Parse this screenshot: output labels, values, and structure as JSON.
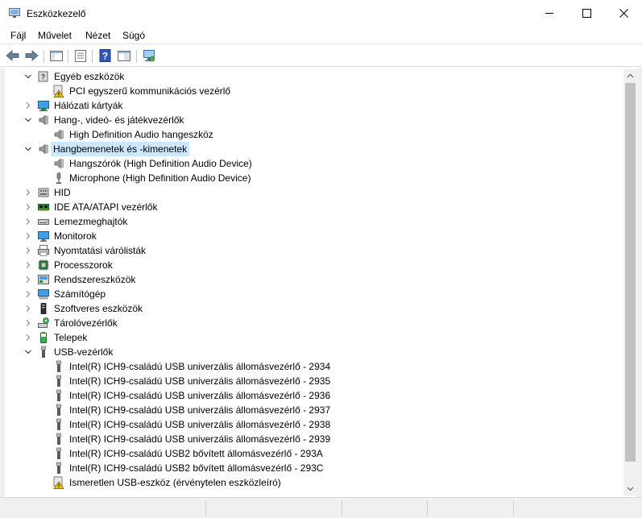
{
  "window": {
    "title": "Eszközkezelő"
  },
  "menu": [
    "Fájl",
    "Művelet",
    "Nézet",
    "Súgó"
  ],
  "toolbar": [
    "back-icon",
    "forward-icon",
    "show-hide-tree-icon",
    "properties-icon",
    "help-icon",
    "view-icon",
    "scan-hardware-icon"
  ],
  "tree": [
    {
      "label": "Egyéb eszközök",
      "level": 1,
      "expander": "open",
      "icon": "unknown-device-icon"
    },
    {
      "label": "PCI egyszerű kommunikációs vezérlő",
      "level": 2,
      "expander": "none",
      "icon": "warning-device-icon"
    },
    {
      "label": "Hálózati kártyák",
      "level": 1,
      "expander": "closed",
      "icon": "network-adapter-icon"
    },
    {
      "label": "Hang-, videó- és játékvezérlők",
      "level": 1,
      "expander": "open",
      "icon": "speaker-icon"
    },
    {
      "label": "High Definition Audio hangeszköz",
      "level": 2,
      "expander": "none",
      "icon": "speaker-icon"
    },
    {
      "label": "Hangbemenetek és -kimenetek",
      "level": 1,
      "expander": "open",
      "icon": "speaker-icon",
      "selected": true
    },
    {
      "label": "Hangszórók (High Definition Audio Device)",
      "level": 2,
      "expander": "none",
      "icon": "speaker-icon"
    },
    {
      "label": "Microphone (High Definition Audio Device)",
      "level": 2,
      "expander": "none",
      "icon": "microphone-icon"
    },
    {
      "label": "HID",
      "level": 1,
      "expander": "closed",
      "icon": "hid-icon"
    },
    {
      "label": "IDE ATA/ATAPI vezérlők",
      "level": 1,
      "expander": "closed",
      "icon": "ide-controller-icon"
    },
    {
      "label": "Lemezmeghajtók",
      "level": 1,
      "expander": "closed",
      "icon": "disk-drive-icon"
    },
    {
      "label": "Monitorok",
      "level": 1,
      "expander": "closed",
      "icon": "monitor-icon"
    },
    {
      "label": "Nyomtatási várólisták",
      "level": 1,
      "expander": "closed",
      "icon": "printer-queue-icon"
    },
    {
      "label": "Processzorok",
      "level": 1,
      "expander": "closed",
      "icon": "processor-icon"
    },
    {
      "label": "Rendszereszközök",
      "level": 1,
      "expander": "closed",
      "icon": "system-device-icon"
    },
    {
      "label": "Számítógép",
      "level": 1,
      "expander": "closed",
      "icon": "computer-icon"
    },
    {
      "label": "Szoftveres eszközök",
      "level": 1,
      "expander": "closed",
      "icon": "software-device-icon"
    },
    {
      "label": "Tárolóvezérlők",
      "level": 1,
      "expander": "closed",
      "icon": "storage-controller-icon"
    },
    {
      "label": "Telepek",
      "level": 1,
      "expander": "closed",
      "icon": "battery-icon"
    },
    {
      "label": "USB-vezérlők",
      "level": 1,
      "expander": "open",
      "icon": "usb-icon"
    },
    {
      "label": "Intel(R) ICH9-családú USB univerzális állomásvezérlő - 2934",
      "level": 2,
      "expander": "none",
      "icon": "usb-icon"
    },
    {
      "label": "Intel(R) ICH9-családú USB univerzális állomásvezérlő - 2935",
      "level": 2,
      "expander": "none",
      "icon": "usb-icon"
    },
    {
      "label": "Intel(R) ICH9-családú USB univerzális állomásvezérlő - 2936",
      "level": 2,
      "expander": "none",
      "icon": "usb-icon"
    },
    {
      "label": "Intel(R) ICH9-családú USB univerzális állomásvezérlő - 2937",
      "level": 2,
      "expander": "none",
      "icon": "usb-icon"
    },
    {
      "label": "Intel(R) ICH9-családú USB univerzális állomásvezérlő - 2938",
      "level": 2,
      "expander": "none",
      "icon": "usb-icon"
    },
    {
      "label": "Intel(R) ICH9-családú USB univerzális állomásvezérlő - 2939",
      "level": 2,
      "expander": "none",
      "icon": "usb-icon"
    },
    {
      "label": "Intel(R) ICH9-családú USB2 bővített állomásvezérlő - 293A",
      "level": 2,
      "expander": "none",
      "icon": "usb-icon"
    },
    {
      "label": "Intel(R) ICH9-családú USB2 bővített állomásvezérlő - 293C",
      "level": 2,
      "expander": "none",
      "icon": "usb-icon"
    },
    {
      "label": "Ismeretlen USB-eszköz (érvénytelen eszközleíró)",
      "level": 2,
      "expander": "none",
      "icon": "warning-device-icon"
    }
  ]
}
